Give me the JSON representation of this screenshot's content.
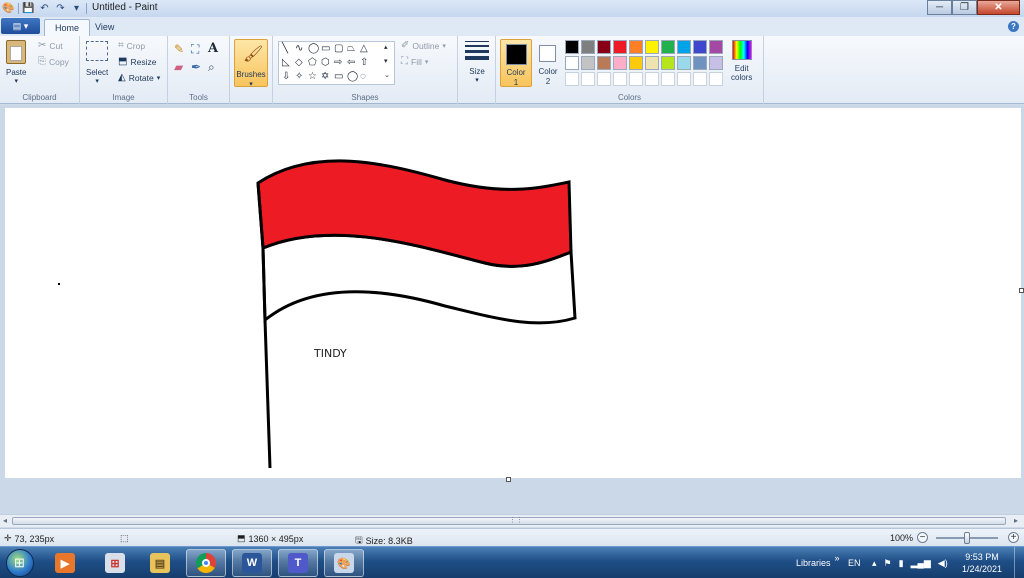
{
  "window": {
    "title": "Untitled - Paint",
    "qat_icons": [
      "paint-icon",
      "save-icon",
      "undo-icon",
      "redo-icon",
      "customize-icon"
    ],
    "controls": {
      "minimize": "─",
      "maximize": "❐",
      "close": "✕"
    }
  },
  "tabs": [
    {
      "label": "Home",
      "active": true
    },
    {
      "label": "View",
      "active": false
    }
  ],
  "ribbon": {
    "clipboard": {
      "paste": "Paste",
      "cut": "Cut",
      "copy": "Copy",
      "group": "Clipboard"
    },
    "image": {
      "select": "Select",
      "crop": "Crop",
      "resize": "Resize",
      "rotate": "Rotate",
      "group": "Image"
    },
    "tools": {
      "group": "Tools",
      "text_glyph": "A"
    },
    "brushes": {
      "label": "Brushes"
    },
    "shapes": {
      "outline": "Outline",
      "fill": "Fill",
      "group": "Shapes"
    },
    "size": {
      "label": "Size"
    },
    "colors": {
      "color1_label": "Color",
      "color1_num": "1",
      "color2_label": "Color",
      "color2_num": "2",
      "color1": "#000000",
      "color2": "#ffffff",
      "edit_label": "Edit",
      "edit_label2": "colors",
      "group": "Colors",
      "palette": [
        "#000000",
        "#7f7f7f",
        "#880015",
        "#ed1c24",
        "#ff7f27",
        "#fff200",
        "#22b14c",
        "#00a2e8",
        "#3f48cc",
        "#a349a4",
        "#ffffff",
        "#c3c3c3",
        "#b97a57",
        "#ffaec9",
        "#ffc90e",
        "#efe4b0",
        "#b5e61d",
        "#99d9ea",
        "#7092be",
        "#c8bfe7",
        "#ffffff",
        "#ffffff",
        "#ffffff",
        "#ffffff",
        "#ffffff",
        "#ffffff",
        "#ffffff",
        "#ffffff",
        "#ffffff",
        "#ffffff"
      ]
    }
  },
  "canvas": {
    "text": "TINDY",
    "flag_top_color": "#ed1c24",
    "flag_bottom_color": "#ffffff"
  },
  "status": {
    "cursor_pos": "73, 235px",
    "image_size": "1360 × 495px",
    "file_size": "Size: 8.3KB",
    "zoom": "100%"
  },
  "taskbar": {
    "apps": [
      "media-player-icon",
      "network-icon",
      "file-explorer-icon",
      "chrome-icon",
      "word-icon",
      "teams-icon",
      "paint-icon"
    ],
    "word_letter": "W",
    "teams_letter": "T",
    "libraries": "Libraries",
    "chevron": "»",
    "language": "EN",
    "time": "9:53 PM",
    "date": "1/24/2021"
  }
}
